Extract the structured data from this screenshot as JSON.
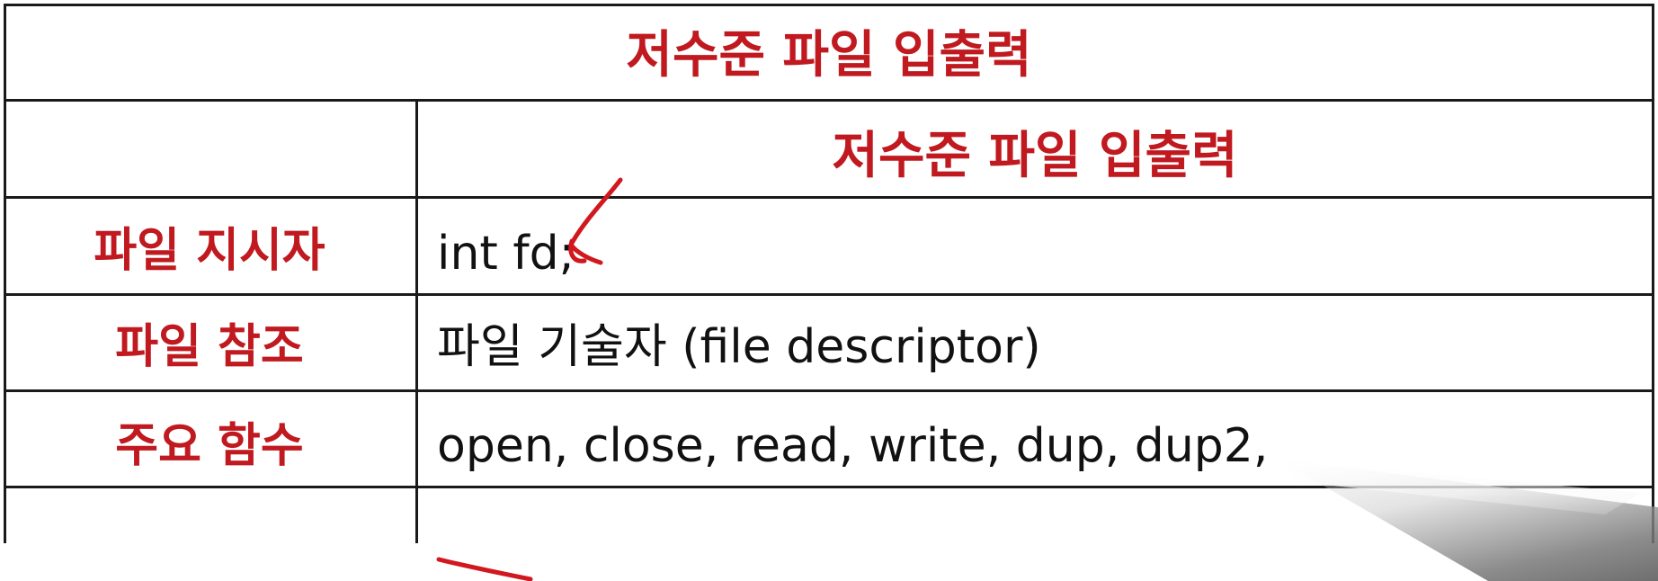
{
  "table": {
    "title": "저수준 파일 입출력",
    "column_header": "저수준 파일 입출력",
    "rows": [
      {
        "label": "파일 지시자",
        "value": "int fd;"
      },
      {
        "label": "파일 참조",
        "value": "파일 기술자 (file descriptor)"
      },
      {
        "label": "주요 함수",
        "value": "open, close, read, write, dup, dup2,"
      }
    ]
  },
  "colors": {
    "heading_red": "#c0191f",
    "body_text": "#111111",
    "border": "#1a1a1a",
    "annotation_red": "#d0181e"
  }
}
